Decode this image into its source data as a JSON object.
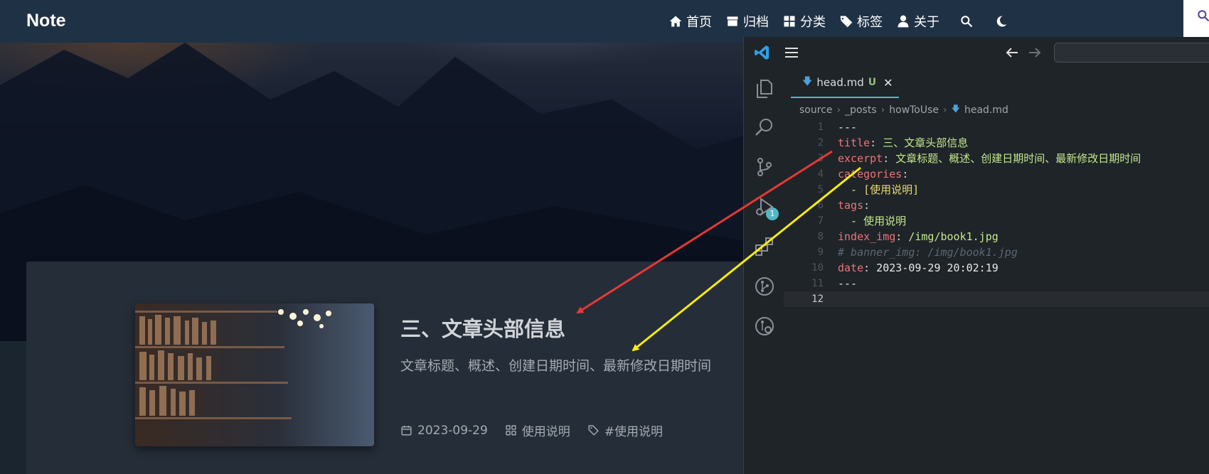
{
  "blog": {
    "brand": "Note",
    "nav": [
      {
        "icon": "home-icon",
        "label": "首页"
      },
      {
        "icon": "archive-icon",
        "label": "归档"
      },
      {
        "icon": "category-icon",
        "label": "分类"
      },
      {
        "icon": "tag-icon",
        "label": "标签"
      },
      {
        "icon": "user-icon",
        "label": "关于"
      }
    ],
    "post": {
      "title": "三、文章头部信息",
      "excerpt": "文章标题、概述、创建日期时间、最新修改日期时间",
      "date": "2023-09-29",
      "category": "使用说明",
      "tag": "#使用说明"
    }
  },
  "editor": {
    "tab": {
      "filename": "head.md",
      "status": "U"
    },
    "breadcrumb": [
      "source",
      "_posts",
      "howToUse",
      "head.md"
    ],
    "scm_badge": "1",
    "lines": [
      {
        "n": "1",
        "key": "",
        "sep": "",
        "val": "---",
        "val_class": "w"
      },
      {
        "n": "2",
        "key": "title",
        "sep": ":",
        "val": " 三、文章头部信息",
        "val_class": "v"
      },
      {
        "n": "3",
        "key": "excerpt",
        "sep": ":",
        "val": " 文章标题、概述、创建日期时间、最新修改日期时间",
        "val_class": "v"
      },
      {
        "n": "4",
        "key": "categories",
        "sep": ":",
        "val": "",
        "val_class": "v"
      },
      {
        "n": "5",
        "key": "",
        "sep": "",
        "val": "  - [使用说明]",
        "val_class": "v2"
      },
      {
        "n": "6",
        "key": "tags",
        "sep": ":",
        "val": "",
        "val_class": "v"
      },
      {
        "n": "7",
        "key": "",
        "sep": "",
        "val": "  - 使用说明",
        "val_class": "v"
      },
      {
        "n": "8",
        "key": "index_img",
        "sep": ":",
        "val": " /img/book1.jpg",
        "val_class": "v"
      },
      {
        "n": "9",
        "key": "",
        "sep": "",
        "val": "# banner_img: /img/book1.jpg",
        "val_class": "cm"
      },
      {
        "n": "10",
        "key": "date",
        "sep": ":",
        "val": " 2023-09-29 20:02:19",
        "val_class": "w"
      },
      {
        "n": "11",
        "key": "",
        "sep": "",
        "val": "---",
        "val_class": "w"
      },
      {
        "n": "12",
        "key": "",
        "sep": "",
        "val": "",
        "val_class": "w"
      }
    ]
  },
  "colors": {
    "navbar": "#1f3145",
    "card": "#252d38",
    "editor_bg": "#1f2428",
    "accent": "#4fb8c8",
    "arrow_red": "#e53935",
    "arrow_yellow": "#ffee00"
  }
}
